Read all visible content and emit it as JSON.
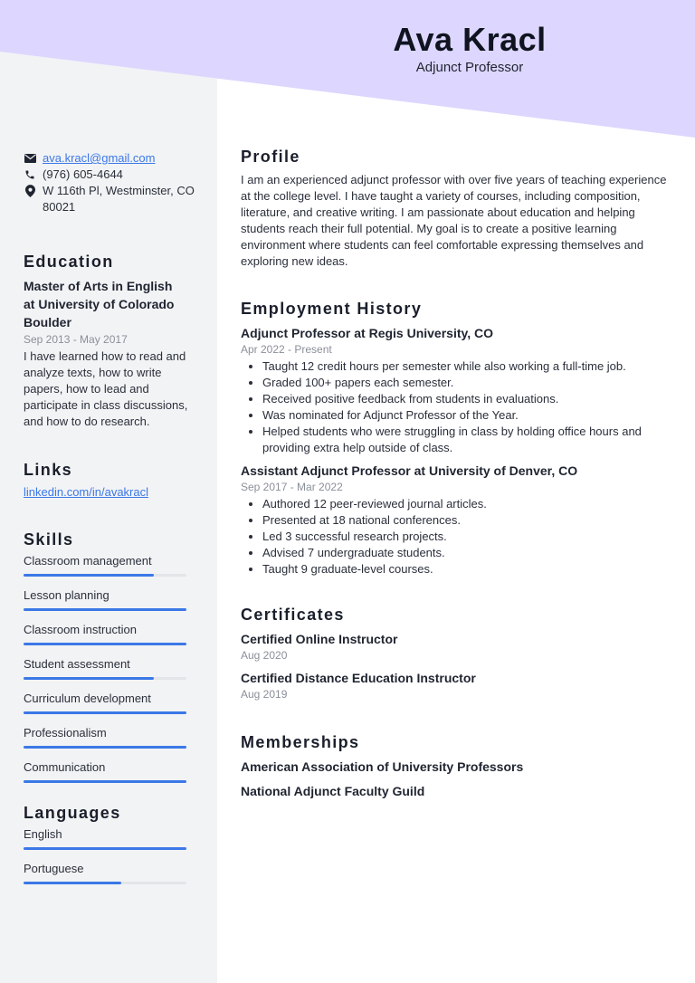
{
  "header": {
    "name": "Ava Kracl",
    "title": "Adjunct Professor"
  },
  "colors": {
    "header_band": "#ddd6fe",
    "sidebar": "#f2f3f5",
    "accent": "#3b78e7"
  },
  "contact": {
    "email": "ava.kracl@gmail.com",
    "phone": "(976) 605-4644",
    "address_line1": "W 116th Pl, Westminster, CO",
    "address_line2": "80021"
  },
  "education": {
    "heading": "Education",
    "degree_line1": "Master of Arts in English",
    "degree_line2": "at University of Colorado",
    "degree_line3": "Boulder",
    "dates": "Sep 2013 - May 2017",
    "description": "I have learned how to read and analyze texts, how to write papers, how to lead and participate in class discussions, and how to do research."
  },
  "links": {
    "heading": "Links",
    "items": [
      {
        "label": "linkedin.com/in/avakracl"
      }
    ]
  },
  "skills": {
    "heading": "Skills",
    "items": [
      {
        "name": "Classroom management",
        "level": 0.8
      },
      {
        "name": "Lesson planning",
        "level": 1.0
      },
      {
        "name": "Classroom instruction",
        "level": 1.0
      },
      {
        "name": "Student assessment",
        "level": 0.8
      },
      {
        "name": "Curriculum development",
        "level": 1.0
      },
      {
        "name": "Professionalism",
        "level": 1.0
      },
      {
        "name": "Communication",
        "level": 1.0
      }
    ]
  },
  "languages": {
    "heading": "Languages",
    "items": [
      {
        "name": "English",
        "level": 1.0
      },
      {
        "name": "Portuguese",
        "level": 0.6
      }
    ]
  },
  "profile": {
    "heading": "Profile",
    "text": "I am an experienced adjunct professor with over five years of teaching experience at the college level. I have taught a variety of courses, including composition, literature, and creative writing. I am passionate about education and helping students reach their full potential. My goal is to create a positive learning environment where students can feel comfortable expressing themselves and exploring new ideas."
  },
  "employment": {
    "heading": "Employment History",
    "jobs": [
      {
        "title": "Adjunct Professor at Regis University, CO",
        "dates": "Apr 2022 - Present",
        "bullets": [
          "Taught 12 credit hours per semester while also working a full-time job.",
          "Graded 100+ papers each semester.",
          "Received positive feedback from students in evaluations.",
          "Was nominated for Adjunct Professor of the Year.",
          "Helped students who were struggling in class by holding office hours and providing extra help outside of class."
        ]
      },
      {
        "title": "Assistant Adjunct Professor at University of Denver, CO",
        "dates": "Sep 2017 - Mar 2022",
        "bullets": [
          "Authored 12 peer-reviewed journal articles.",
          "Presented at 18 national conferences.",
          "Led 3 successful research projects.",
          "Advised 7 undergraduate students.",
          "Taught 9 graduate-level courses."
        ]
      }
    ]
  },
  "certificates": {
    "heading": "Certificates",
    "items": [
      {
        "name": "Certified Online Instructor",
        "date": "Aug 2020"
      },
      {
        "name": "Certified Distance Education Instructor",
        "date": "Aug 2019"
      }
    ]
  },
  "memberships": {
    "heading": "Memberships",
    "items": [
      "American Association of University Professors",
      "National Adjunct Faculty Guild"
    ]
  }
}
